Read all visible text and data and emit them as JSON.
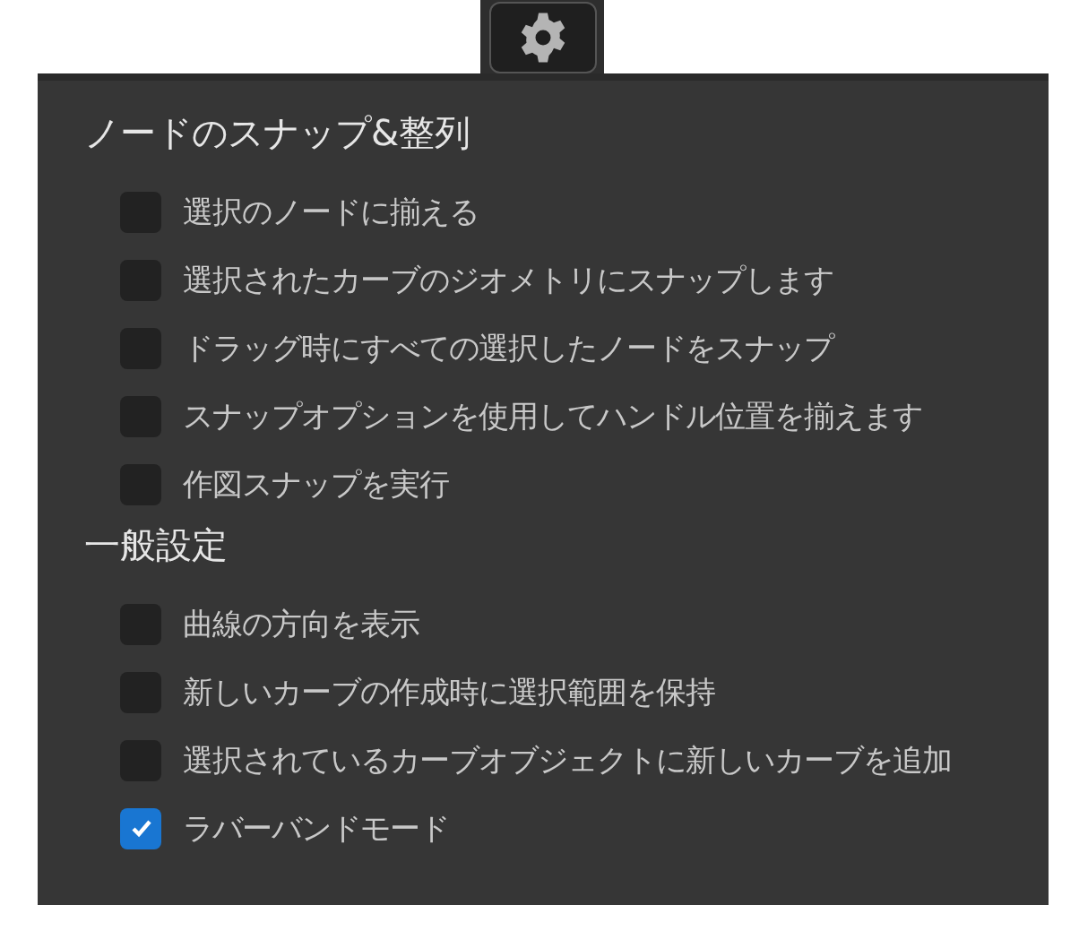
{
  "sections": [
    {
      "title": "ノードのスナップ&整列",
      "options": [
        {
          "label": "選択のノードに揃える",
          "checked": false
        },
        {
          "label": "選択されたカーブのジオメトリにスナップします",
          "checked": false
        },
        {
          "label": "ドラッグ時にすべての選択したノードをスナップ",
          "checked": false
        },
        {
          "label": "スナップオプションを使用してハンドル位置を揃えます",
          "checked": false
        },
        {
          "label": "作図スナップを実行",
          "checked": false
        }
      ]
    },
    {
      "title": "一般設定",
      "options": [
        {
          "label": "曲線の方向を表示",
          "checked": false
        },
        {
          "label": "新しいカーブの作成時に選択範囲を保持",
          "checked": false
        },
        {
          "label": "選択されているカーブオブジェクトに新しいカーブを追加",
          "checked": false
        },
        {
          "label": "ラバーバンドモード",
          "checked": true
        }
      ]
    }
  ]
}
